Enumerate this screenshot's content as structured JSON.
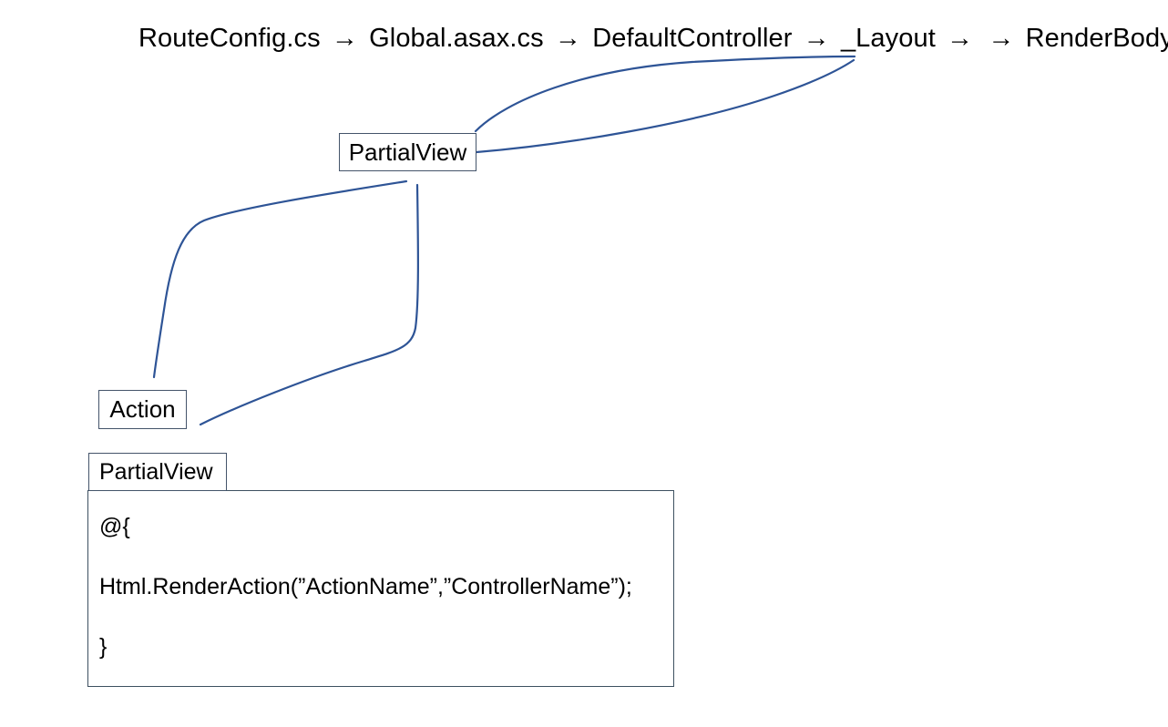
{
  "diagram": {
    "title_pipeline": {
      "steps": [
        "RouteConfig.cs",
        "Global.asax.cs",
        "DefaultController",
        "_Layout",
        "RenderBody"
      ],
      "arrow_glyph": "→",
      "tail": "…..",
      "full_text": "RouteConfig.cs → Global.asax.cs → DefaultController → _Layout → → RenderBody →…..",
      "extra_arrow_after_layout": "→"
    },
    "nodes": {
      "partial_view_top": "PartialView",
      "action": "Action"
    },
    "code_panel": {
      "tab_label": "PartialView",
      "lines": [
        "@{",
        "Html.RenderAction(”ActionName”,”ControllerName”);",
        "}"
      ]
    },
    "colors": {
      "connector_line": "#2e5496",
      "box_border": "#44546a",
      "code_box_border": "#3d5060",
      "text": "#000000",
      "background": "#ffffff"
    },
    "connectors": [
      {
        "name": "partialview-top-to-renderbody",
        "from": "PartialView box top-right",
        "to": "_Layout / RenderBody arrow area"
      },
      {
        "name": "partialview-right-to-renderbody",
        "from": "PartialView box right edge",
        "to": "_Layout / RenderBody arrow area"
      },
      {
        "name": "partialview-bottom-left-to-action",
        "from": "PartialView box bottom-left",
        "to": "above Action box"
      },
      {
        "name": "partialview-bottom-to-action-right",
        "from": "PartialView box bottom",
        "to": "right of Action box"
      }
    ]
  }
}
